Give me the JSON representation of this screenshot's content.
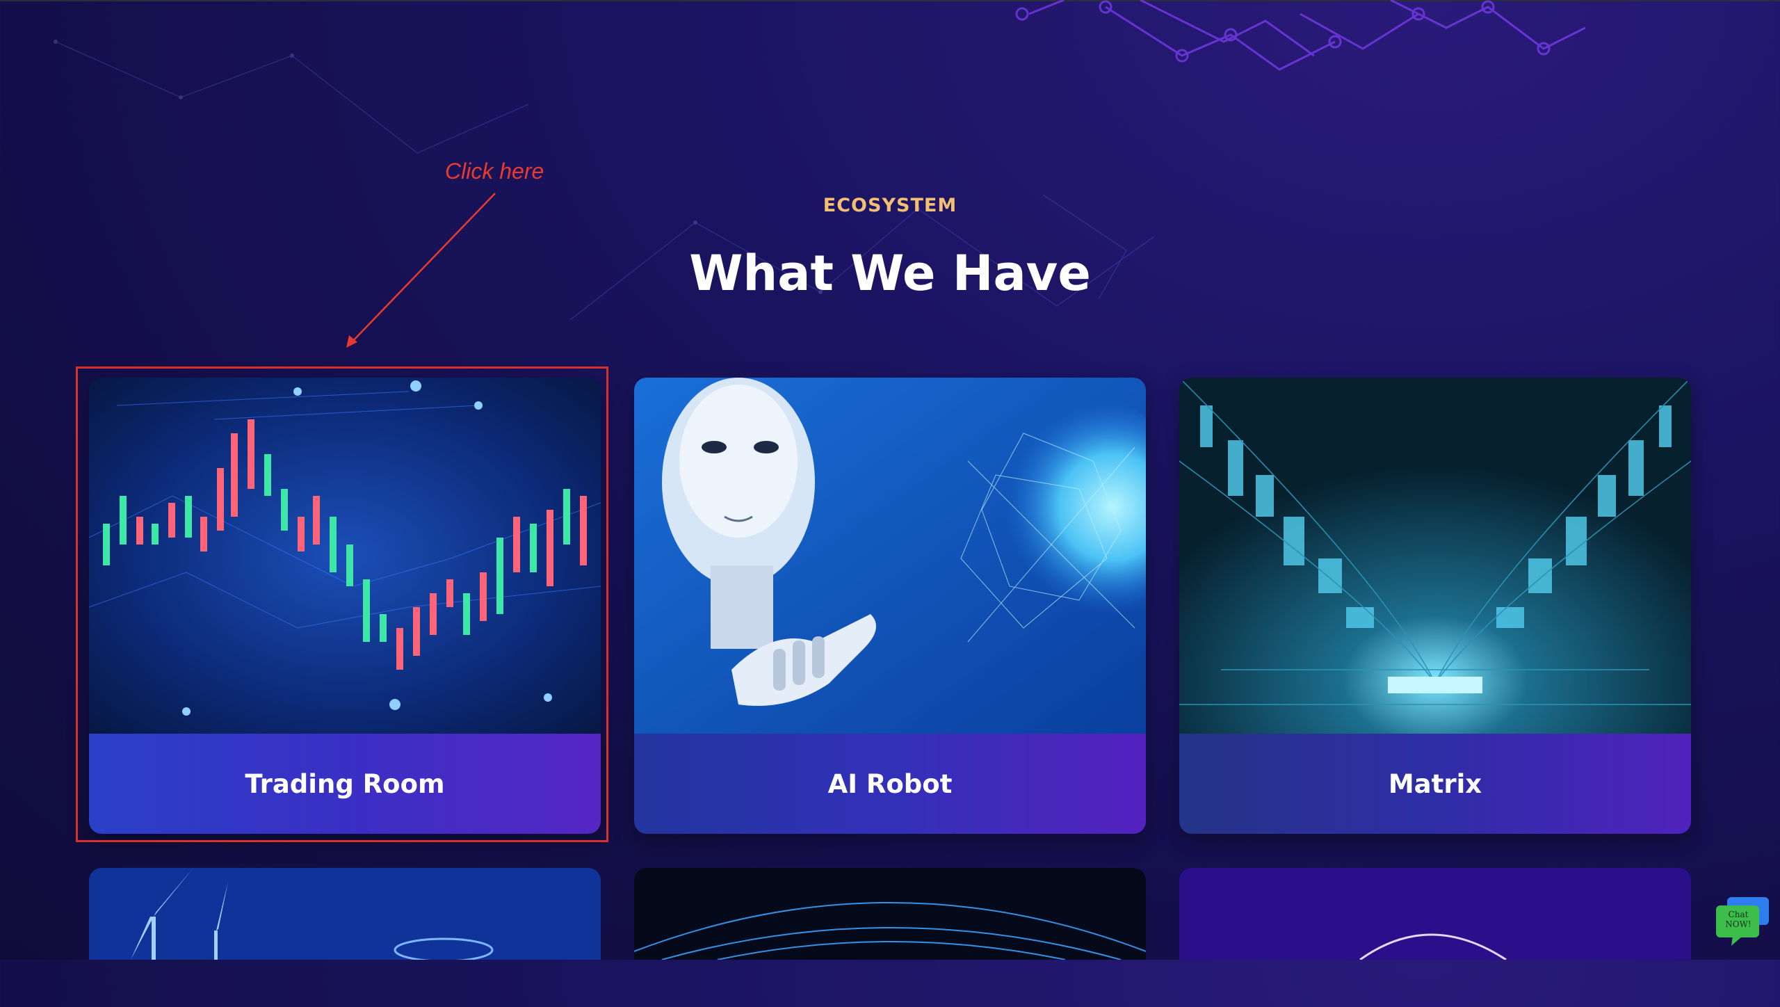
{
  "annotation": {
    "text": "Click here"
  },
  "section": {
    "eyebrow": "ECOSYSTEM",
    "title": "What We Have"
  },
  "cards": [
    {
      "label": "Trading Room",
      "icon": "candlestick-chart-image"
    },
    {
      "label": "AI Robot",
      "icon": "robot-image"
    },
    {
      "label": "Matrix",
      "icon": "data-corridor-image"
    },
    {
      "icon": "wind-turbine-image"
    },
    {
      "icon": "network-globe-image"
    },
    {
      "icon": "purple-sphere-image"
    }
  ],
  "chat": {
    "text": "Chat NOW!"
  },
  "colors": {
    "eyebrow": "#f2bf73",
    "annotation": "#e63b2e",
    "background": "#140f4a"
  }
}
